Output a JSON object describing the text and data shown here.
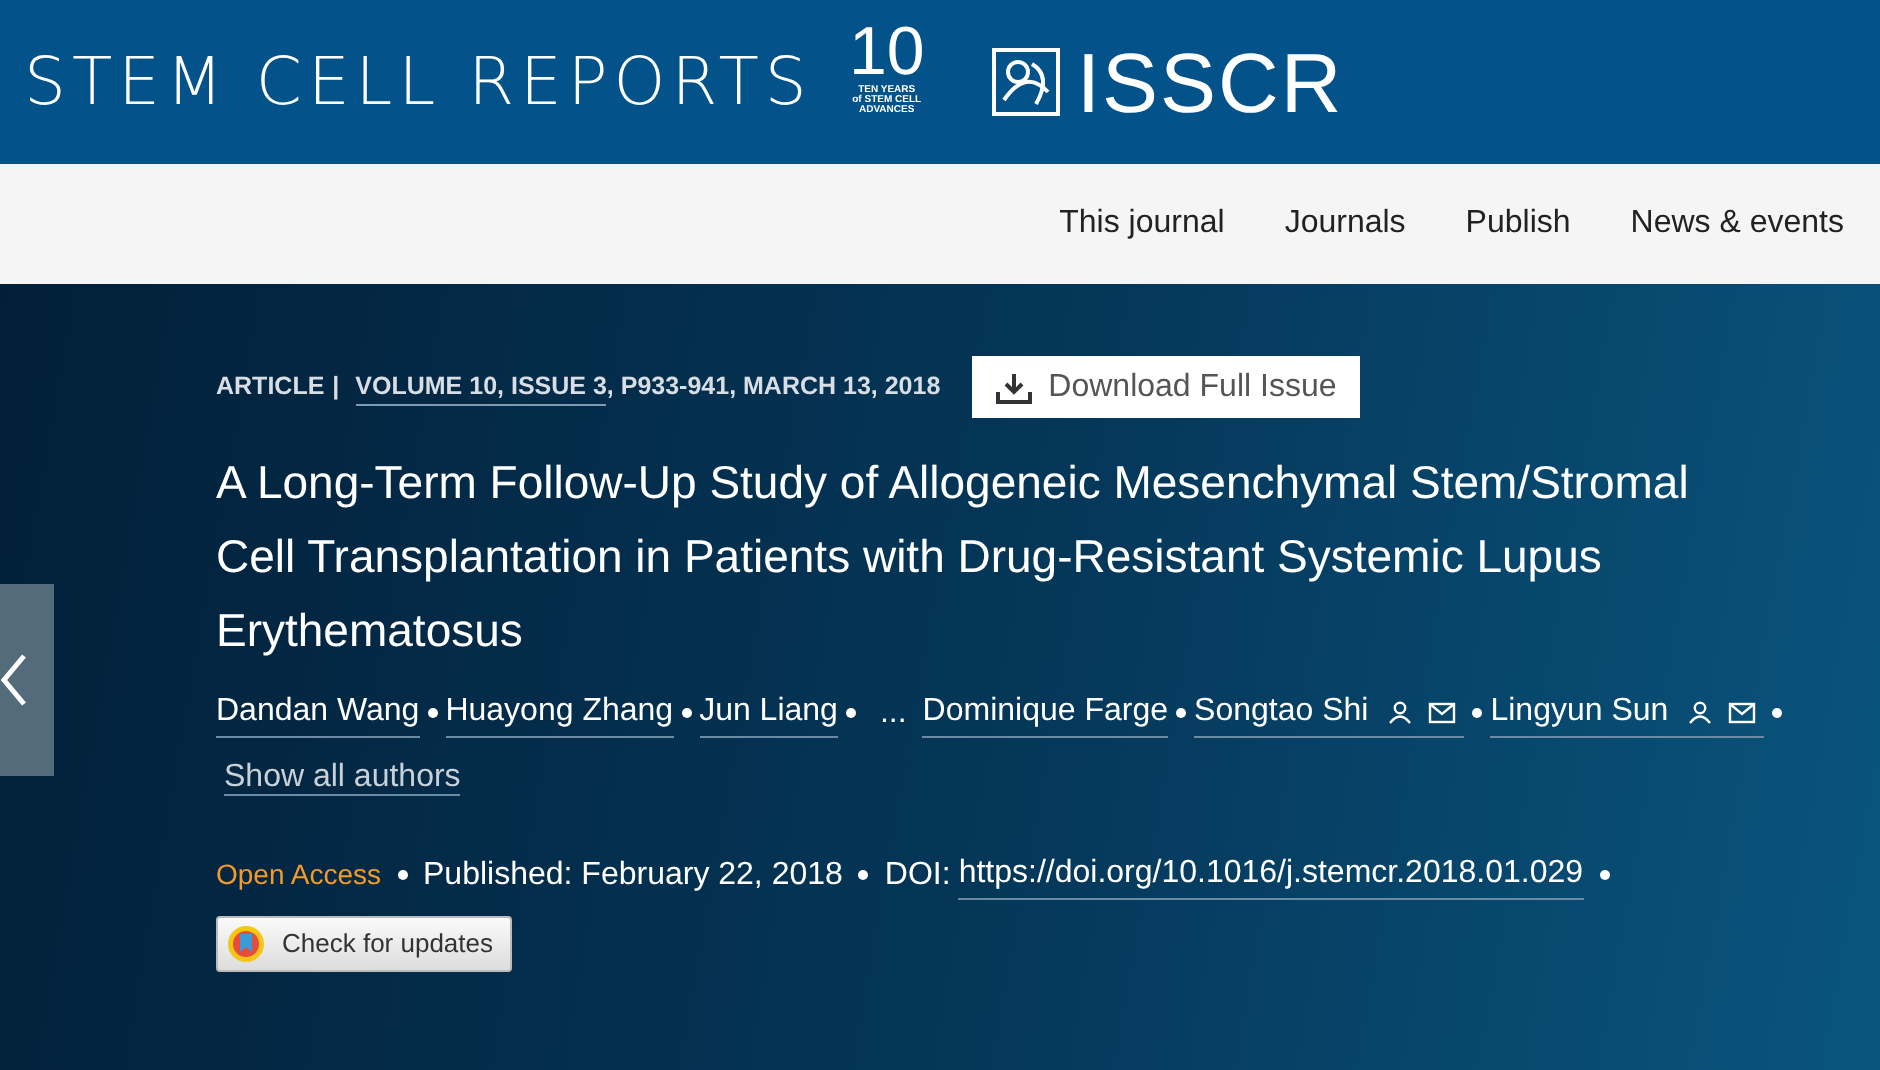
{
  "header": {
    "journal_title": "STEM CELL REPORTS",
    "anniversary": {
      "numeral": "10",
      "caption": [
        "TEN YEARS",
        "of STEM CELL",
        "ADVANCES"
      ]
    },
    "society": "ISSCR"
  },
  "nav": [
    {
      "label": "This journal"
    },
    {
      "label": "Journals"
    },
    {
      "label": "Publish"
    },
    {
      "label": "News & events"
    }
  ],
  "article": {
    "type": "ARTICLE",
    "separator": "|",
    "volume_link": "VOLUME 10, ISSUE 3",
    "citation_rest": ", P933-941, MARCH 13, 2018",
    "download_button": "Download Full Issue",
    "title": "A Long-Term Follow-Up Study of Allogeneic Mesenchymal Stem/Stromal Cell Transplantation in Patients with Drug-Resistant Systemic Lupus Erythematosus",
    "authors": [
      {
        "kind": "author",
        "name": "Dandan Wang",
        "corresponding": false
      },
      {
        "kind": "author",
        "name": "Huayong Zhang",
        "corresponding": false
      },
      {
        "kind": "author",
        "name": "Jun Liang",
        "corresponding": false
      },
      {
        "kind": "ellipsis",
        "name": "..."
      },
      {
        "kind": "author",
        "name": "Dominique Farge",
        "corresponding": false
      },
      {
        "kind": "author",
        "name": "Songtao Shi",
        "corresponding": true
      },
      {
        "kind": "author",
        "name": "Lingyun Sun",
        "corresponding": true
      }
    ],
    "show_all_authors": "Show all authors",
    "access": "Open Access",
    "published": "Published: February 22, 2018",
    "doi_label": "DOI:",
    "doi": "https://doi.org/10.1016/j.stemcr.2018.01.029",
    "check_updates": "Check for updates"
  }
}
